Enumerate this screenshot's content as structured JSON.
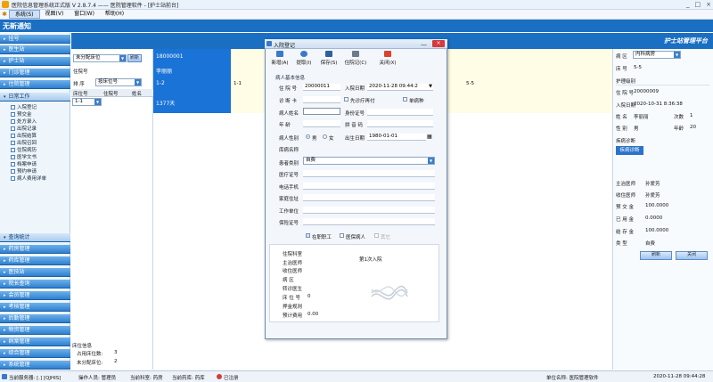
{
  "window": {
    "title": "医院信息管理系统正式版 V 2.8.7.4 —— 医院管理软件 - [护士站前台]",
    "controls": [
      "_",
      "□",
      "×"
    ]
  },
  "menu": [
    "系统(S)",
    "视图(V)",
    "窗口(W)",
    "帮助(H)"
  ],
  "notice": "无新通知",
  "header_brand": "护士站管理平台",
  "left_nav": {
    "top_groups": [
      "挂号",
      "医生站",
      "护士站",
      "门诊管理",
      "住院管理"
    ],
    "sub_group": "日常工作",
    "tree_items": [
      "入院登记",
      "预交金",
      "处方录入",
      "出院记录",
      "出院结算",
      "出院召回",
      "住院病历",
      "医学文书",
      "档案申请",
      "预约申请",
      "病人费用详单"
    ],
    "stats_group": "查询统计",
    "bottom_groups": [
      "药房管理",
      "药库管理",
      "医技站",
      "院长查询",
      "会员管理",
      "考核管理",
      "后勤管理",
      "物资管理",
      "病案管理",
      "综合管理",
      "系统管理"
    ]
  },
  "bed_panel": {
    "filter_value": "未分配床位",
    "filter_button": "刷新",
    "hospital_no_label": "住院号",
    "sort_label": "排 序",
    "sort_value": "按床位号",
    "columns": [
      "床位号",
      "住院号",
      "姓名"
    ],
    "row_value": "1-1",
    "bed_info_label": "床位信息",
    "occupied_label": "占用床位数:",
    "occupied_value": "3",
    "unassigned_label": "未分配床位:",
    "unassigned_value": "2"
  },
  "cards": {
    "card1": {
      "id": "18000001",
      "name": "李丽丽",
      "bed": "1-2",
      "days": "1377天"
    },
    "card2_bed": "1-1",
    "card3_bed": "5-5"
  },
  "dialog": {
    "title": "入院登记",
    "min": "—",
    "close": "×",
    "toolbar": [
      {
        "label": "新增(A)",
        "color": "#3a78c9"
      },
      {
        "label": "提取(I)",
        "color": "#3a78c9"
      },
      {
        "label": "保存(S)",
        "color": "#2f5f9c"
      },
      {
        "label": "住院记(C)",
        "color": "#6f7b88"
      },
      {
        "label": "关闭(X)",
        "color": "#d9442f"
      }
    ],
    "section": "病人基本信息",
    "hospital_no_label": "住 院 号",
    "hospital_no_value": "20000011",
    "admit_date_label": "入院日期",
    "admit_date_value": "2020-11-28 09:44:2",
    "card_no_label": "诊 断 卡",
    "first_diag_label": "先诊疗再付",
    "single_disease_label": "单病种",
    "patient_name_label": "病人姓名",
    "id_card_label": "身份证号",
    "age_label": "年  龄",
    "pinyin_label": "拼 音 码",
    "gender_label": "病人性别",
    "male": "男",
    "female": "女",
    "birth_label": "出生日期",
    "birth_value": "1980-01-01",
    "reg_name_label": "库病名称",
    "patient_type_label": "患者类别",
    "patient_type_value": "自费",
    "med_card_label": "医疗证号",
    "phone_label": "电话手机",
    "address_label": "家庭住址",
    "work_label": "工作单位",
    "insurance_label": "保险证号",
    "checks": [
      "在职职工",
      "医保病人",
      "其它"
    ],
    "info_rows": [
      "住院科室",
      "主治医师",
      "收住医师",
      "病    区",
      "转诊医生",
      "床 位 号",
      "押金规则",
      "预计费用"
    ],
    "bed_no_value": "0",
    "expected_fee_value": "0.00",
    "admit_count": "第1次入院"
  },
  "right_panel": {
    "ward_label": "病    区",
    "ward_value": "内科病房",
    "bed_label": "床    号",
    "bed_value": "5-5",
    "nursing_label": "护理级别",
    "hosp_no_label": "住 院 号",
    "hosp_no_value": "20000009",
    "admit_date_label": "入院日期",
    "admit_date_value": "2020-10-31 8:36:38",
    "name_label": "姓    名",
    "name_value": "李丽丽",
    "times_label": "次数",
    "times_value": "1",
    "gender_label": "性    别",
    "gender_value": "男",
    "age_label": "年龄",
    "age_value": "20",
    "diagnosis_label": "疾病诊断",
    "diagnosis_btn": "疾病诊断",
    "attending_label": "主治医师",
    "attending_value": "孙爱芳",
    "admitting_label": "收住医师",
    "admitting_value": "孙爱芳",
    "prepay_label": "预 交 金",
    "prepay_value": "100.0000",
    "used_label": "已 用 金",
    "used_value": "0.0000",
    "balance_label": "结 存 金",
    "balance_value": "100.0000",
    "type_label": "类    型",
    "type_value": "自费",
    "refresh_btn": "刷新",
    "close_btn": "关闭"
  },
  "status_bar": {
    "server": "当前服务器:  [.]  [QJHIS]",
    "operator": "操作人员: 管理员",
    "dept": "当前科室: 药房",
    "pharmacy": "当前药库: 药库",
    "registered": "已注册",
    "unit": "单位名称: 医院管理软件",
    "time": "2020-11-28 09:44:28"
  }
}
